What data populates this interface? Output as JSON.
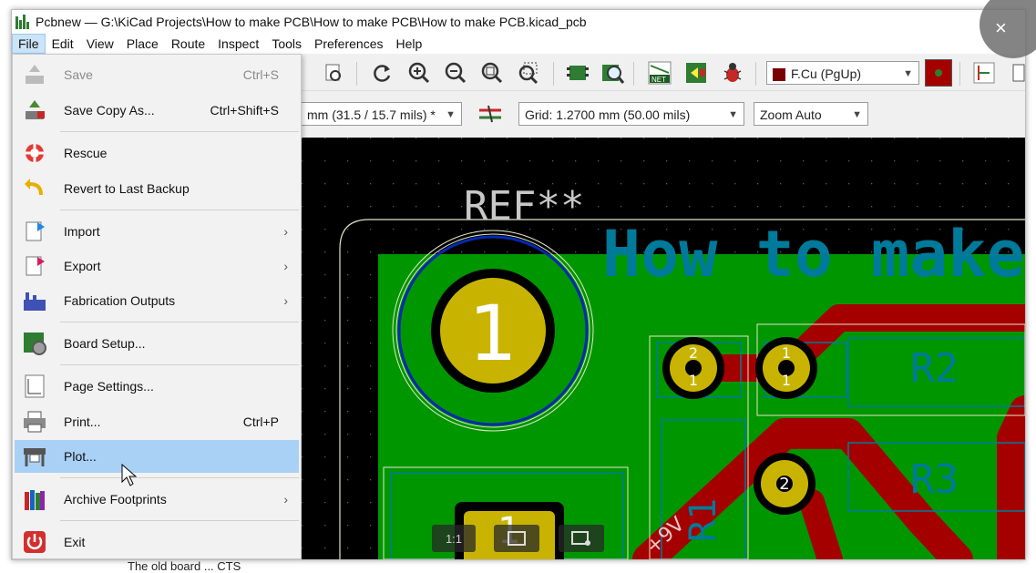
{
  "window": {
    "title": "Pcbnew — G:\\KiCad Projects\\How to make PCB\\How to make PCB\\How to make PCB.kicad_pcb",
    "close_glyph": "×"
  },
  "menubar": {
    "items": [
      "File",
      "Edit",
      "View",
      "Place",
      "Route",
      "Inspect",
      "Tools",
      "Preferences",
      "Help"
    ]
  },
  "toolbar": {
    "layer_select": "F.Cu (PgUp)",
    "track_width": "mm (31.5 / 15.7 mils) *",
    "grid": "Grid: 1.2700 mm (50.00 mils)",
    "zoom": "Zoom Auto",
    "icons": [
      "open-file-icon",
      "redraw-icon",
      "zoom-in-icon",
      "zoom-out-icon",
      "zoom-fit-icon",
      "zoom-selection-icon",
      "footprint-editor-icon",
      "footprint-browser-icon",
      "netlist-icon",
      "update-pcb-icon",
      "drc-bug-icon",
      "layer-pair-icon",
      "router-icon"
    ]
  },
  "file_menu": {
    "items": [
      {
        "label": "Save",
        "shortcut": "Ctrl+S",
        "disabled": true,
        "icon": "save-icon"
      },
      {
        "label": "Save Copy As...",
        "shortcut": "Ctrl+Shift+S",
        "icon": "save-copy-icon"
      },
      {
        "label": "Rescue",
        "icon": "rescue-icon"
      },
      {
        "label": "Revert to Last Backup",
        "icon": "revert-icon"
      },
      {
        "label": "Import",
        "submenu": true,
        "icon": "import-icon"
      },
      {
        "label": "Export",
        "submenu": true,
        "icon": "export-icon"
      },
      {
        "label": "Fabrication Outputs",
        "submenu": true,
        "icon": "fabrication-icon"
      },
      {
        "label": "Board Setup...",
        "icon": "board-setup-icon"
      },
      {
        "label": "Page Settings...",
        "icon": "page-settings-icon"
      },
      {
        "label": "Print...",
        "shortcut": "Ctrl+P",
        "icon": "print-icon"
      },
      {
        "label": "Plot...",
        "highlighted": true,
        "icon": "plot-icon"
      },
      {
        "label": "Archive Footprints",
        "submenu": true,
        "icon": "archive-icon"
      },
      {
        "label": "Exit",
        "icon": "exit-icon"
      }
    ],
    "submenu_glyph": "›"
  },
  "pcb": {
    "ref_text": "REF**",
    "board_text": "How to make",
    "pad1_label": "1",
    "r2_label": "R2",
    "r3_label": "R3",
    "r1_label": "R1",
    "pad_a_top": "2",
    "pad_a_bottom": "1",
    "pad_b_top": "1",
    "pad_b_bottom": "1",
    "pad_c": "2",
    "pad_bottom": "1",
    "net_label": "+9V",
    "colors": {
      "board": "#009600",
      "track": "#a40000",
      "pad": "#c8b400",
      "text": "#007a9a",
      "outline": "#e6e6c8"
    }
  },
  "overlay": {
    "zoom_1to1": "1:1"
  },
  "background_text": "The old board  ...  CTS"
}
